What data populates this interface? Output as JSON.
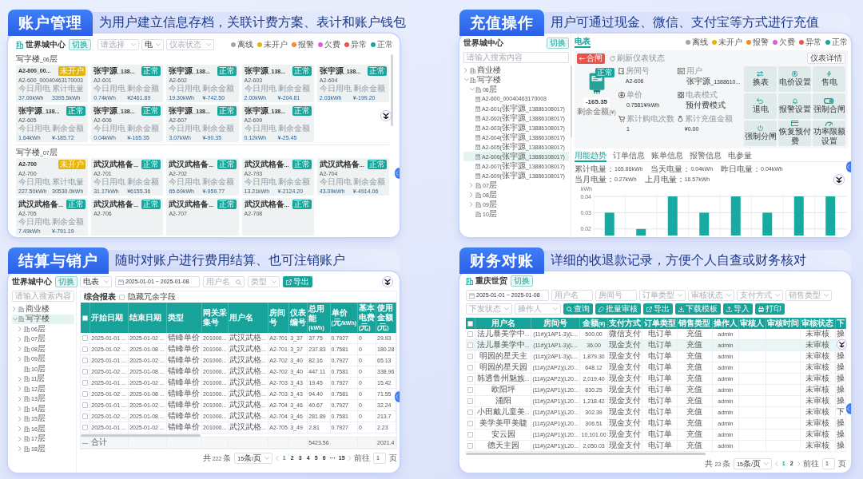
{
  "sections": [
    {
      "kind": "account_cards",
      "title": "账户管理",
      "description": "为用户建立信息存档，关联计费方案、表计和账户钱包",
      "screen": {
        "site": "世界城中心",
        "switch_button": "切换",
        "filters": [
          {
            "placeholder": "请选择"
          },
          {
            "value": "电"
          },
          {
            "placeholder": "仪表状态"
          }
        ],
        "legend": [
          {
            "label": "离线",
            "color": "#a0a6ad"
          },
          {
            "label": "未开户",
            "color": "#e5b50f"
          },
          {
            "label": "报警",
            "color": "#f28c28"
          },
          {
            "label": "欠费",
            "color": "#e25bd9"
          },
          {
            "label": "异常",
            "color": "#ef5350"
          },
          {
            "label": "正常",
            "color": "#16a89d"
          }
        ],
        "groups": [
          {
            "title": "写字楼_06层",
            "cards": [
              {
                "title": "A2-600_00...",
                "status": {
                  "text": "未开户",
                  "color": "#e5b50f"
                },
                "code": "A2-600_00040463170003",
                "fields": [
                  {
                    "label": "今日用电",
                    "value": "37.00kWh"
                  },
                  {
                    "label": "累计电量",
                    "value": "3395.5kWh"
                  }
                ]
              },
              {
                "title": "张宇源_138...",
                "status": {
                  "text": "正常",
                  "color": "#16a89d"
                },
                "code": "A2-601",
                "fields": [
                  {
                    "label": "今日用电",
                    "value": "0.74kWh"
                  },
                  {
                    "label": "剩余金额",
                    "value": "¥2461.89"
                  }
                ]
              },
              {
                "title": "张宇源_138...",
                "status": {
                  "text": "正常",
                  "color": "#16a89d"
                },
                "code": "A2-602",
                "fields": [
                  {
                    "label": "今日用电",
                    "value": "19.30kWh"
                  },
                  {
                    "label": "剩余金额",
                    "value": "¥-742.50"
                  }
                ]
              },
              {
                "title": "张宇源_138...",
                "status": {
                  "text": "正常",
                  "color": "#16a89d"
                },
                "code": "A2-603",
                "fields": [
                  {
                    "label": "今日用电",
                    "value": "2.00kWh"
                  },
                  {
                    "label": "剩余金额",
                    "value": "¥-204.81"
                  }
                ]
              },
              {
                "title": "张宇源_138...",
                "status": {
                  "text": "正常",
                  "color": "#16a89d"
                },
                "code": "A2-604",
                "fields": [
                  {
                    "label": "今日用电",
                    "value": "2.03kWh"
                  },
                  {
                    "label": "剩余金额",
                    "value": "¥-199.20"
                  }
                ]
              },
              {
                "title": "张宇源_138...",
                "status": {
                  "text": "正常",
                  "color": "#16a89d"
                },
                "code": "A2-605",
                "fields": [
                  {
                    "label": "今日用电",
                    "value": "1.64kWh"
                  },
                  {
                    "label": "剩余金额",
                    "value": "¥-185.72"
                  }
                ]
              },
              {
                "title": "张宇源_138...",
                "status": {
                  "text": "正常",
                  "color": "#16a89d"
                },
                "code": "A2-606",
                "fields": [
                  {
                    "label": "今日用电",
                    "value": "0.04kWh"
                  },
                  {
                    "label": "剩余金额",
                    "value": "¥-165.35"
                  }
                ]
              },
              {
                "title": "张宇源_138...",
                "status": {
                  "text": "正常",
                  "color": "#16a89d"
                },
                "code": "A2-607",
                "fields": [
                  {
                    "label": "今日用电",
                    "value": "3.07kWh"
                  },
                  {
                    "label": "剩余金额",
                    "value": "¥-90.35"
                  }
                ]
              },
              {
                "title": "张宇源_138...",
                "status": {
                  "text": "正常",
                  "color": "#16a89d"
                },
                "code": "A2-609",
                "fields": [
                  {
                    "label": "今日用电",
                    "value": "0.12kWh"
                  },
                  {
                    "label": "剩余金额",
                    "value": "¥-25.45"
                  }
                ]
              }
            ]
          },
          {
            "title": "写字楼_07层",
            "cards": [
              {
                "title": "A2-700",
                "status": {
                  "text": "未开户",
                  "color": "#e5b50f"
                },
                "code": "A2-700",
                "fields": [
                  {
                    "label": "今日用电",
                    "value": "227.50kWh"
                  },
                  {
                    "label": "累计电量",
                    "value": "30530.0kWh"
                  }
                ]
              },
              {
                "title": "武汉武格备...",
                "status": {
                  "text": "正常",
                  "color": "#16a89d"
                },
                "code": "A2-701",
                "fields": [
                  {
                    "label": "今日用电",
                    "value": "31.17kWh"
                  },
                  {
                    "label": "剩余金额",
                    "value": "¥6155.36"
                  }
                ]
              },
              {
                "title": "武汉武格备...",
                "status": {
                  "text": "正常",
                  "color": "#16a89d"
                },
                "code": "A2-702",
                "fields": [
                  {
                    "label": "今日用电",
                    "value": "65.69kWh"
                  },
                  {
                    "label": "剩余金额",
                    "value": "¥-959.77"
                  }
                ]
              },
              {
                "title": "武汉武格备...",
                "status": {
                  "text": "正常",
                  "color": "#16a89d"
                },
                "code": "A2-703",
                "fields": [
                  {
                    "label": "今日用电",
                    "value": "13.21kWh"
                  },
                  {
                    "label": "剩余金额",
                    "value": "¥-2124.20"
                  }
                ]
              },
              {
                "title": "武汉武格备...",
                "status": {
                  "text": "正常",
                  "color": "#16a89d"
                },
                "code": "A2-704",
                "fields": [
                  {
                    "label": "今日用电",
                    "value": "43.09kWh"
                  },
                  {
                    "label": "剩余金额",
                    "value": "¥-4914.06"
                  }
                ]
              },
              {
                "title": "武汉武格备...",
                "status": {
                  "text": "正常",
                  "color": "#16a89d"
                },
                "code": "A2-705",
                "fields": [
                  {
                    "label": "今日用电",
                    "value": "7.49kWh"
                  },
                  {
                    "label": "剩余金额",
                    "value": "¥-791.19"
                  }
                ]
              },
              {
                "title": "武汉武格备...",
                "status": {
                  "text": "正常",
                  "color": "#16a89d"
                },
                "code": "A2-706"
              },
              {
                "title": "武汉武格备...",
                "status": {
                  "text": "正常",
                  "color": "#16a89d"
                },
                "code": "A2-707"
              },
              {
                "title": "武汉武格备...",
                "status": {
                  "text": "正常",
                  "color": "#16a89d"
                },
                "code": "A2-708"
              }
            ]
          }
        ]
      }
    },
    {
      "kind": "recharge",
      "title": "充值操作",
      "description": "用户可通过现金、微信、支付宝等方式进行充值",
      "screen": {
        "sidebar": {
          "site": "世界城中心",
          "switch_button": "切换",
          "search": {
            "placeholder": "请输入搜索内容"
          },
          "tree": [
            {
              "kind": "branch",
              "label": "商业楼",
              "expanded": false,
              "selected": false
            },
            {
              "kind": "branch",
              "label": "写字楼",
              "expanded": true,
              "selected": false,
              "children": [
                {
                  "kind": "branch",
                  "label": "06层",
                  "expanded": true,
                  "selected": false,
                  "children": [
                    {
                      "kind": "meter",
                      "label": "A2-600_00040463170003",
                      "selected": false
                    },
                    {
                      "kind": "meter",
                      "label": "A2-601(张宇源_13886108017)",
                      "selected": false
                    },
                    {
                      "kind": "meter",
                      "label": "A2-602(张宇源_13886108017)",
                      "selected": false
                    },
                    {
                      "kind": "meter",
                      "label": "A2-603(张宇源_13886108017)",
                      "selected": false
                    },
                    {
                      "kind": "meter",
                      "label": "A2-604(张宇源_13886108017)",
                      "selected": false
                    },
                    {
                      "kind": "meter",
                      "label": "A2-605(张宇源_13886108017)",
                      "selected": false
                    },
                    {
                      "kind": "meter",
                      "label": "A2-606(张宇源_13886108017)",
                      "selected": true
                    },
                    {
                      "kind": "meter",
                      "label": "A2-607(张宇源_13886108017)",
                      "selected": false
                    },
                    {
                      "kind": "meter",
                      "label": "A2-609(张宇源_13886108017)",
                      "selected": false
                    }
                  ]
                },
                {
                  "kind": "branch",
                  "label": "07层",
                  "expanded": false,
                  "selected": false
                },
                {
                  "kind": "branch",
                  "label": "08层",
                  "expanded": false,
                  "selected": false
                },
                {
                  "kind": "branch",
                  "label": "09层",
                  "expanded": false,
                  "selected": false
                },
                {
                  "kind": "folder",
                  "label": "10层",
                  "selected": false
                }
              ]
            }
          ]
        },
        "tabs": [
          {
            "label": "电表",
            "selected": true
          }
        ],
        "legend": [
          {
            "label": "离线",
            "color": "#a0a6ad"
          },
          {
            "label": "未开户",
            "color": "#e5b50f"
          },
          {
            "label": "报警",
            "color": "#f28c28"
          },
          {
            "label": "欠费",
            "color": "#e25bd9"
          },
          {
            "label": "异常",
            "color": "#ef5350"
          },
          {
            "label": "正常",
            "color": "#16a89d"
          }
        ],
        "meter": {
          "breaker_tag": "合闸",
          "refresh": "刷新仪表状态",
          "status": "正常",
          "balance": "-165.35",
          "balance_label": "剩余金额(¥)",
          "detail_button": "仪表详情",
          "info": [
            {
              "label": "房间号",
              "value": "A2-606"
            },
            {
              "label": "用户",
              "value": "张宇源_1388610..."
            },
            {
              "label": "单价",
              "value": "0.7581¥/kWh"
            },
            {
              "label": "电表模式",
              "value": "预付费模式"
            },
            {
              "label": "累计购电次数",
              "value": "1"
            },
            {
              "label": "累计充值金额",
              "value": "¥0.00"
            }
          ],
          "actions": [
            "换表",
            "电价设置",
            "售电",
            "退电",
            "报警设置",
            "强制合闸",
            "强制分闸",
            "恢复预付费",
            "功率限额设置"
          ]
        },
        "detail_tabs": [
          {
            "label": "用能趋势",
            "selected": true
          },
          {
            "label": "订单信息",
            "selected": false
          },
          {
            "label": "账单信息",
            "selected": false
          },
          {
            "label": "报警信息",
            "selected": false
          },
          {
            "label": "电参量",
            "selected": false
          }
        ],
        "stats": [
          {
            "label": "累计电量：",
            "value": "165.86kWh"
          },
          {
            "label": "当天电量：",
            "value": "0.04kWh"
          },
          {
            "label": "昨日电量：",
            "value": "0.04kWh"
          },
          {
            "label": "当月电量：",
            "value": "0.27kWh"
          },
          {
            "label": "上月电量：",
            "value": "16.57kWh"
          }
        ],
        "chart_data": {
          "type": "bar",
          "ylabel": "kWh",
          "ylim": [
            0.016,
            0.04
          ],
          "yticks": [
            0.02,
            0.03,
            0.04
          ],
          "values": [
            0.03,
            0.02,
            0.04,
            0.03,
            0.04,
            0.03,
            0.04,
            0.04
          ]
        }
      }
    },
    {
      "kind": "settlement",
      "title": "结算与销户",
      "description": "随时对账户进行费用结算、也可注销账户",
      "screen": {
        "sidebar": {
          "site": "世界城中心",
          "switch_button": "切换",
          "search": {
            "placeholder": "请输入搜索内容"
          },
          "tree": [
            {
              "kind": "branch",
              "label": "商业楼",
              "expanded": false,
              "selected": false
            },
            {
              "kind": "branch",
              "label": "写字楼",
              "expanded": true,
              "selected": true,
              "children": [
                {
                  "kind": "branch",
                  "label": "06层",
                  "expanded": false,
                  "selected": false
                },
                {
                  "kind": "branch",
                  "label": "07层",
                  "expanded": false,
                  "selected": false
                },
                {
                  "kind": "branch",
                  "label": "08层",
                  "expanded": false,
                  "selected": false
                },
                {
                  "kind": "branch",
                  "label": "09层",
                  "expanded": false,
                  "selected": false
                },
                {
                  "kind": "folder",
                  "label": "10层",
                  "selected": false
                },
                {
                  "kind": "branch",
                  "label": "11层",
                  "expanded": false,
                  "selected": false
                },
                {
                  "kind": "branch",
                  "label": "12层",
                  "expanded": false,
                  "selected": false
                },
                {
                  "kind": "branch",
                  "label": "13层",
                  "expanded": false,
                  "selected": false
                },
                {
                  "kind": "branch",
                  "label": "14层",
                  "expanded": false,
                  "selected": false
                },
                {
                  "kind": "branch",
                  "label": "15层",
                  "expanded": false,
                  "selected": false
                },
                {
                  "kind": "branch",
                  "label": "16层",
                  "expanded": false,
                  "selected": false
                },
                {
                  "kind": "branch",
                  "label": "17层",
                  "expanded": false,
                  "selected": false
                },
                {
                  "kind": "branch",
                  "label": "18层",
                  "expanded": false,
                  "selected": false
                }
              ]
            }
          ]
        },
        "toolbar": [
          {
            "kind": "select",
            "value": "电表"
          },
          {
            "kind": "date_range",
            "start": "2025-01-01",
            "separator": "~",
            "end": "2025-01-08"
          },
          {
            "kind": "search",
            "placeholder": "用户名"
          },
          {
            "kind": "select",
            "placeholder": "类型"
          }
        ],
        "export_button": "导出",
        "report": {
          "title": "综合报表",
          "option": {
            "label": "隐藏冗余字段",
            "checked": false
          }
        },
        "table": {
          "all_checked": false,
          "columns": [
            "开始日期",
            "结束日期",
            "类型",
            "网关采集号",
            "用户名",
            "房间号",
            "仪表编号",
            "总用能(kWh)",
            "单价(元/kWh)",
            "基本电费(元)",
            "使用金额(元)"
          ],
          "rows": [
            {
              "checked": false,
              "start": "2025-01-01 ...",
              "end": "2025-01-02 ...",
              "type": "错峰单价",
              "gateway": "201000...",
              "user": "武汉武格...",
              "room": "A2-701",
              "meter": "3_37",
              "energy": "37.75",
              "price": "0.7927",
              "base_fee": "0",
              "amount": "29.93"
            },
            {
              "checked": false,
              "start": "2025-01-02 ...",
              "end": "2025-01-08 ...",
              "type": "错峰单价",
              "gateway": "201000...",
              "user": "武汉武格...",
              "room": "A2-701",
              "meter": "3_37",
              "energy": "237.83",
              "price": "0.7581",
              "base_fee": "0",
              "amount": "180.28"
            },
            {
              "checked": false,
              "start": "2025-01-01 ...",
              "end": "2025-01-02 ...",
              "type": "错峰单价",
              "gateway": "201000...",
              "user": "武汉武格...",
              "room": "A2-702",
              "meter": "3_40",
              "energy": "82.16",
              "price": "0.7927",
              "base_fee": "0",
              "amount": "65.13"
            },
            {
              "checked": false,
              "start": "2025-01-02 ...",
              "end": "2025-01-08 ...",
              "type": "错峰单价",
              "gateway": "201000...",
              "user": "武汉武格...",
              "room": "A2-702",
              "meter": "3_40",
              "energy": "447.11",
              "price": "0.7581",
              "base_fee": "0",
              "amount": "338.96"
            },
            {
              "checked": false,
              "start": "2025-01-01 ...",
              "end": "2025-01-02 ...",
              "type": "错峰单价",
              "gateway": "201000...",
              "user": "武汉武格...",
              "room": "A2-703",
              "meter": "3_43",
              "energy": "19.45",
              "price": "0.7927",
              "base_fee": "0",
              "amount": "15.42"
            },
            {
              "checked": false,
              "start": "2025-01-02 ...",
              "end": "2025-01-08 ...",
              "type": "错峰单价",
              "gateway": "201000...",
              "user": "武汉武格...",
              "room": "A2-703",
              "meter": "3_43",
              "energy": "94.40",
              "price": "0.7581",
              "base_fee": "0",
              "amount": "71.55"
            },
            {
              "checked": false,
              "start": "2025-01-01 ...",
              "end": "2025-01-02 ...",
              "type": "错峰单价",
              "gateway": "201000...",
              "user": "武汉武格...",
              "room": "A2-704",
              "meter": "3_46",
              "energy": "40.67",
              "price": "0.7927",
              "base_fee": "0",
              "amount": "32.24"
            },
            {
              "checked": false,
              "start": "2025-01-02 ...",
              "end": "2025-01-08 ...",
              "type": "错峰单价",
              "gateway": "201000...",
              "user": "武汉武格...",
              "room": "A2-704",
              "meter": "3_46",
              "energy": "281.89",
              "price": "0.7581",
              "base_fee": "0",
              "amount": "213.7"
            },
            {
              "checked": false,
              "start": "2025-01-01 ...",
              "end": "2025-01-02 ...",
              "type": "错峰单价",
              "gateway": "201000...",
              "user": "武汉武格...",
              "room": "A2-705",
              "meter": "3_49",
              "energy": "2.81",
              "price": "0.7927",
              "base_fee": "0",
              "amount": "2.23"
            }
          ],
          "footer": {
            "marker": "—",
            "label": "合计",
            "total_energy": "5423.56",
            "total_amount": "2021.4"
          }
        },
        "pagination": {
          "total": "共 222 条",
          "page_size": "15条/页",
          "pages": [
            {
              "label": "1",
              "selected": true
            },
            {
              "label": "2",
              "selected": false
            },
            {
              "label": "3",
              "selected": false
            },
            {
              "label": "4",
              "selected": false
            },
            {
              "label": "5",
              "selected": false
            },
            {
              "label": "6",
              "selected": false
            },
            {
              "label": "···",
              "selected": false
            },
            {
              "label": "15",
              "selected": false
            }
          ],
          "goto": "前往",
          "page_input": "1",
          "page_unit": "页"
        }
      }
    },
    {
      "kind": "reconciliation",
      "title": "财务对账",
      "description": "详细的收退款记录，方便个人自查或财务核对",
      "screen": {
        "site": "重庆世贸",
        "switch_button": "切换",
        "filters": [
          {
            "kind": "date_range",
            "start": "2025-01-01",
            "separator": "~",
            "end": "2025-01-08"
          },
          {
            "kind": "input",
            "placeholder": "用户名"
          },
          {
            "kind": "input",
            "placeholder": "房间号"
          },
          {
            "kind": "select",
            "placeholder": "订单类型"
          },
          {
            "kind": "select",
            "placeholder": "审核状态"
          },
          {
            "kind": "select",
            "placeholder": "支付方式"
          },
          {
            "kind": "select",
            "placeholder": "销售类型"
          },
          {
            "kind": "select",
            "placeholder": "下发状态"
          },
          {
            "kind": "select",
            "placeholder": "操作人"
          }
        ],
        "buttons": [
          "查询",
          "批量审核",
          "导出",
          "下载模板",
          "导入",
          "打印"
        ],
        "table": {
          "all_checked": false,
          "columns": [
            "用户名",
            "房间号",
            "金额(¥)",
            "支付方式",
            "订单类型",
            "销售类型",
            "操作人",
            "审核人",
            "审核时间",
            "审核状态",
            "下"
          ],
          "rows": [
            {
              "checked": false,
              "selected": false,
              "user": "法儿暴美学中...",
              "room": "(11#)(1AP1-3)(L...",
              "amount": "500.00",
              "payment": "微信支付",
              "order_type": "电订单",
              "sale_type": "充值",
              "operator": "admin",
              "review_status": "未审核",
              "column_11": "操"
            },
            {
              "checked": false,
              "selected": true,
              "user": "法儿暴美学中...",
              "room": "(11#)(1AP1-3)(L...",
              "amount": "36.00",
              "payment": "现金支付",
              "order_type": "电订单",
              "sale_type": "充值",
              "operator": "admin",
              "review_status": "未审核"
            },
            {
              "checked": false,
              "selected": false,
              "user": "明园的星天主",
              "room": "(11#)(2AP1-3)(L...",
              "amount": "1,879.30",
              "payment": "现金支付",
              "order_type": "电订单",
              "sale_type": "充值",
              "operator": "admin",
              "review_status": "未审核",
              "column_11": "操"
            },
            {
              "checked": false,
              "selected": false,
              "user": "明园的星天园",
              "room": "(11#)(2AP2)(L20...",
              "amount": "648.12",
              "payment": "现金支付",
              "order_type": "电订单",
              "sale_type": "充值",
              "operator": "admin",
              "review_status": "未审核",
              "column_11": "操"
            },
            {
              "checked": false,
              "selected": false,
              "user": "韩透鲁州魅族...",
              "room": "(11#)(2AP2)(L20...",
              "amount": "2,019.40",
              "payment": "现金支付",
              "order_type": "电订单",
              "sale_type": "充值",
              "operator": "admin",
              "review_status": "未审核",
              "column_11": "操"
            },
            {
              "checked": false,
              "selected": false,
              "user": "欧阳坪",
              "room": "(11#)(2AP1)(L20...",
              "amount": "830.25",
              "payment": "现金支付",
              "order_type": "电订单",
              "sale_type": "充值",
              "operator": "admin",
              "review_status": "未审核",
              "column_11": "操"
            },
            {
              "checked": false,
              "selected": false,
              "user": "涌阳",
              "room": "(11#)(2AP1)(L20...",
              "amount": "1,218.42",
              "payment": "现金支付",
              "order_type": "电订单",
              "sale_type": "充值",
              "operator": "admin",
              "review_status": "未审核",
              "column_11": "操"
            },
            {
              "checked": false,
              "selected": false,
              "user": "小田戴儿童美...",
              "room": "(11#)(2AP1)(L20...",
              "amount": "302.39",
              "payment": "现金支付",
              "order_type": "电订单",
              "sale_type": "充值",
              "operator": "admin",
              "review_status": "未审核",
              "column_11": "下"
            },
            {
              "checked": false,
              "selected": false,
              "user": "美学美甲美睫",
              "room": "(11#)(2AP1)(L20...",
              "amount": "306.51",
              "payment": "现金支付",
              "order_type": "电订单",
              "sale_type": "充值",
              "operator": "admin",
              "review_status": "未审核",
              "column_11": "操"
            },
            {
              "checked": false,
              "selected": false,
              "user": "安云园",
              "room": "(11#)(2AP1)(L20...",
              "amount": "10,101.00",
              "payment": "现金支付",
              "order_type": "电订单",
              "sale_type": "充值",
              "operator": "admin",
              "review_status": "未审核",
              "column_11": "操"
            },
            {
              "checked": false,
              "selected": false,
              "user": "德天主园",
              "room": "(11#)(2AP1)(L20...",
              "amount": "2,050.03",
              "payment": "现金支付",
              "order_type": "电订单",
              "sale_type": "充值",
              "operator": "admin",
              "review_status": "未审核",
              "column_11": "操"
            }
          ]
        },
        "pagination": {
          "total": "共 23 条",
          "page_size": "15条/页",
          "pages": [
            {
              "label": "1",
              "selected": true
            },
            {
              "label": "2",
              "selected": false
            }
          ],
          "goto": "前往",
          "page_input": "1",
          "page_unit": "页"
        }
      }
    }
  ]
}
